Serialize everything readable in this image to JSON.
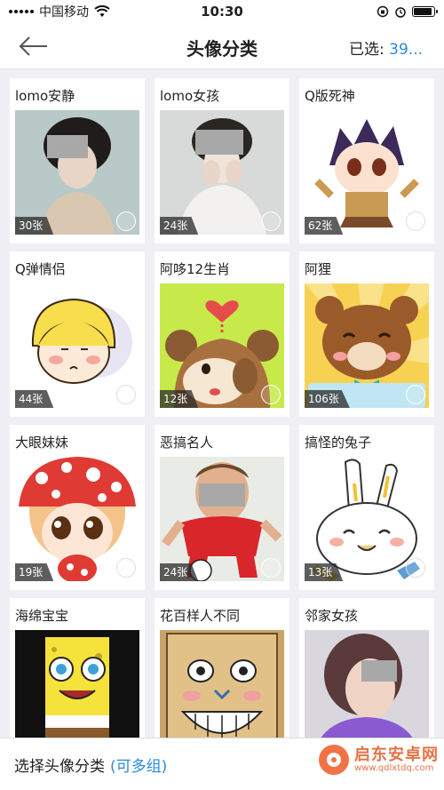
{
  "status_bar": {
    "carrier": "中国移动",
    "time": "10:30"
  },
  "nav": {
    "title": "头像分类",
    "selected_label": "已选:",
    "selected_count": "39..."
  },
  "categories": [
    {
      "title": "lomo安静",
      "count": "30张"
    },
    {
      "title": "lomo女孩",
      "count": "24张"
    },
    {
      "title": "Q版死神",
      "count": "62张"
    },
    {
      "title": "Q弹情侣",
      "count": "44张"
    },
    {
      "title": "阿哆12生肖",
      "count": "12张"
    },
    {
      "title": "阿狸",
      "count": "106张"
    },
    {
      "title": "大眼妹妹",
      "count": "19张"
    },
    {
      "title": "恶搞名人",
      "count": "24张"
    },
    {
      "title": "搞怪的兔子",
      "count": "13张"
    },
    {
      "title": "海绵宝宝",
      "count": ""
    },
    {
      "title": "花百样人不同",
      "count": ""
    },
    {
      "title": "邻家女孩",
      "count": ""
    }
  ],
  "bottom_bar": {
    "label": "选择头像分类",
    "hint": "(可多组)"
  },
  "watermark": {
    "title": "启东安卓网",
    "url": "www.qdlxtdq.com"
  },
  "colors": {
    "accent": "#2a8ae0",
    "background": "#efeff4"
  }
}
